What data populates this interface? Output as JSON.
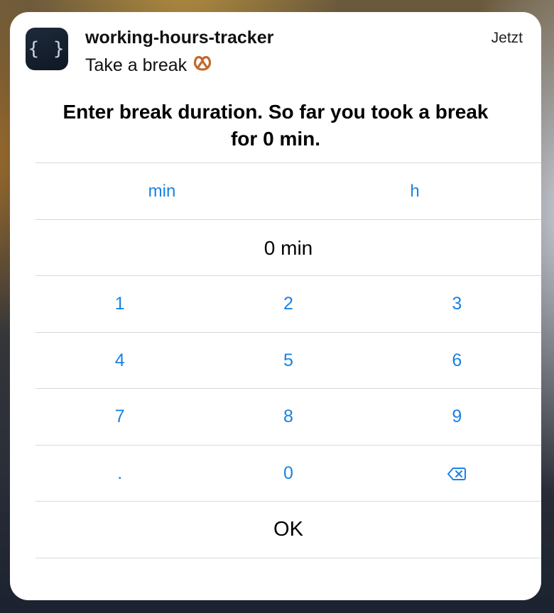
{
  "notification": {
    "app_name": "working-hours-tracker",
    "timestamp": "Jetzt",
    "subtitle": "Take a break",
    "app_icon_glyph": "{ }",
    "subtitle_emoji": "pretzel-icon"
  },
  "prompt": {
    "text": "Enter break duration. So far you took a break for 0 min."
  },
  "units": {
    "min": "min",
    "h": "h"
  },
  "display": {
    "value": "0 min"
  },
  "keypad": {
    "rows": [
      [
        "1",
        "2",
        "3"
      ],
      [
        "4",
        "5",
        "6"
      ],
      [
        "7",
        "8",
        "9"
      ],
      [
        ".",
        "0",
        "backspace-icon"
      ]
    ]
  },
  "ok_label": "OK",
  "colors": {
    "accent": "#1a82e2",
    "text": "#000000",
    "divider": "#d8d8d8"
  }
}
